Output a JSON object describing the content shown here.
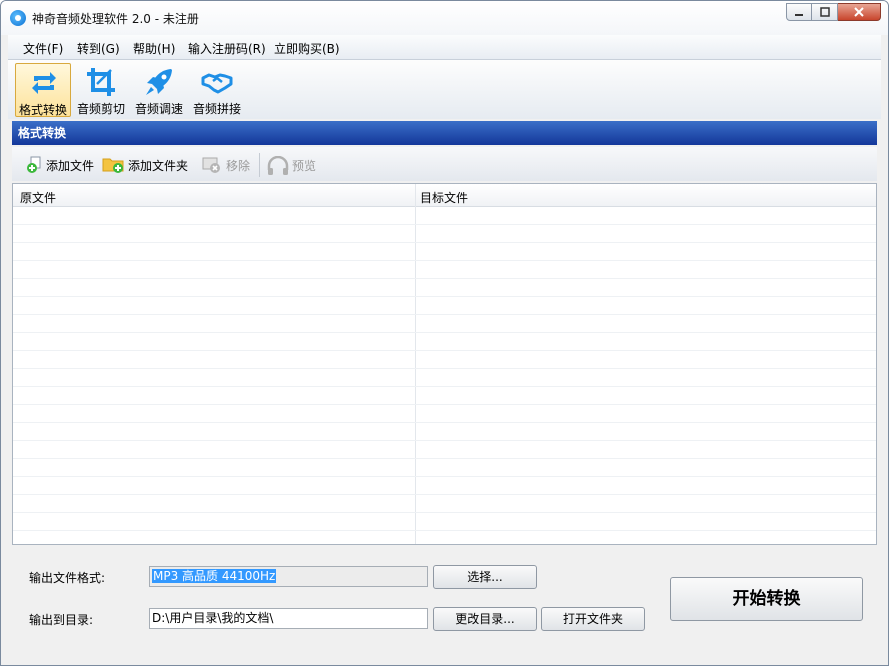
{
  "window": {
    "title": "神奇音频处理软件 2.0 - 未注册"
  },
  "menu": [
    {
      "label": "文件(F)"
    },
    {
      "label": "转到(G)"
    },
    {
      "label": "帮助(H)"
    },
    {
      "label": "输入注册码(R)"
    },
    {
      "label": "立即购买(B)"
    }
  ],
  "tools": [
    {
      "label": "格式转换",
      "icon": "convert-icon",
      "active": true
    },
    {
      "label": "音频剪切",
      "icon": "crop-icon",
      "active": false
    },
    {
      "label": "音频调速",
      "icon": "rocket-icon",
      "active": false
    },
    {
      "label": "音频拼接",
      "icon": "handshake-icon",
      "active": false
    }
  ],
  "section": {
    "title": "格式转换"
  },
  "subtoolbar": {
    "add_file": "添加文件",
    "add_folder": "添加文件夹",
    "remove": "移除",
    "preview": "预览"
  },
  "table": {
    "columns": [
      "原文件",
      "目标文件"
    ],
    "rows": []
  },
  "output": {
    "format_label": "输出文件格式:",
    "format_value": "MP3 高品质 44100Hz",
    "choose_button": "选择...",
    "dir_label": "输出到目录:",
    "dir_value": "D:\\用户目录\\我的文档\\",
    "change_dir_button": "更改目录...",
    "open_folder_button": "打开文件夹",
    "start_button": "开始转换"
  },
  "colors": {
    "accent": "#1e4fb0",
    "icon_blue": "#1f8fe6",
    "active_tool": "#fde29a"
  }
}
